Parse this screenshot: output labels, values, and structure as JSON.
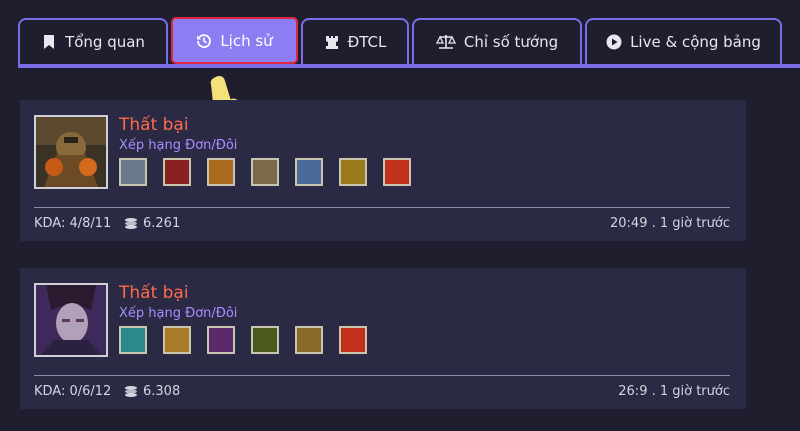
{
  "tabs": [
    {
      "label": "Tổng quan",
      "icon": "bookmark-icon"
    },
    {
      "label": "Lịch sử",
      "icon": "history-icon",
      "active": true
    },
    {
      "label": "ĐTCL",
      "icon": "rook-icon"
    },
    {
      "label": "Chỉ số tướng",
      "icon": "scale-icon"
    },
    {
      "label": "Live & cộng bảng",
      "icon": "play-icon"
    }
  ],
  "matches": [
    {
      "result": "Thất bại",
      "queue": "Xếp hạng Đơn/Đôi",
      "kda": "KDA: 4/8/11",
      "gold": "6.261",
      "time": "20:49 . 1 giờ trước",
      "items": [
        "item-1",
        "item-2",
        "item-3",
        "item-4",
        "item-5",
        "item-6",
        "item-7"
      ]
    },
    {
      "result": "Thất bại",
      "queue": "Xếp hạng Đơn/Đôi",
      "kda": "KDA: 0/6/12",
      "gold": "6.308",
      "time": "26:9 . 1 giờ trước",
      "items": [
        "item-1",
        "item-2",
        "item-3",
        "item-4",
        "item-5",
        "item-6"
      ]
    }
  ],
  "colors": {
    "accent": "#7b6ce8",
    "active_tab": "#8c7ef2",
    "defeat": "#ff6a4d",
    "queue": "#a98cff"
  }
}
